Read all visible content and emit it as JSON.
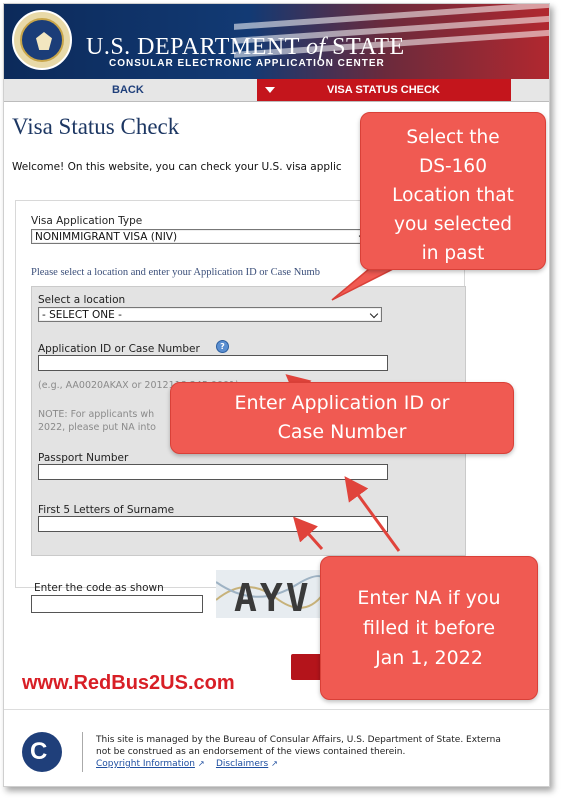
{
  "header": {
    "dept_prefix": "U.S. DEPARTMENT",
    "dept_of": "of",
    "dept_suffix": "STATE",
    "subtitle": "CONSULAR ELECTRONIC APPLICATION CENTER"
  },
  "nav": {
    "back_label": "BACK",
    "current_label": "VISA STATUS CHECK"
  },
  "page": {
    "title": "Visa Status Check",
    "welcome": "Welcome! On this website, you can check your U.S. visa applic"
  },
  "form": {
    "application_type_label": "Visa Application Type",
    "application_type_value": "NONIMMIGRANT VISA (NIV)",
    "instruction": "Please select a location and enter your Application ID or Case Numb",
    "location_label": "Select a location",
    "location_value": "- SELECT ONE -",
    "app_id_label": "Application ID or Case Number",
    "app_id_example": "(e.g., AA0020AKAX or 2012118 345 0001)",
    "note_line1": "NOTE: For applicants wh",
    "note_line2": "2022, please put NA into",
    "passport_label": "Passport Number",
    "surname_label": "First 5 Letters of Surname",
    "code_label": "Enter the code as shown",
    "captcha_text": "AYV"
  },
  "callouts": {
    "location": [
      "Select the",
      "DS-160",
      "Location that",
      "you selected",
      "in past"
    ],
    "app_id": [
      "Enter Application ID or",
      "Case Number"
    ],
    "na": [
      "Enter NA if you",
      "filled it before",
      "Jan 1, 2022"
    ]
  },
  "watermark": "www.RedBus2US.com",
  "footer": {
    "line1": "This site is managed by the Bureau of Consular Affairs, U.S. Department of State. Externa",
    "line2": "not be construed as an endorsement of the views contained therein.",
    "copyright_link": "Copyright Information",
    "disclaimers_link": "Disclaimers"
  },
  "colors": {
    "brand_navy": "#1d3763",
    "nav_red": "#c4151c",
    "callout_red": "#f05a52"
  }
}
